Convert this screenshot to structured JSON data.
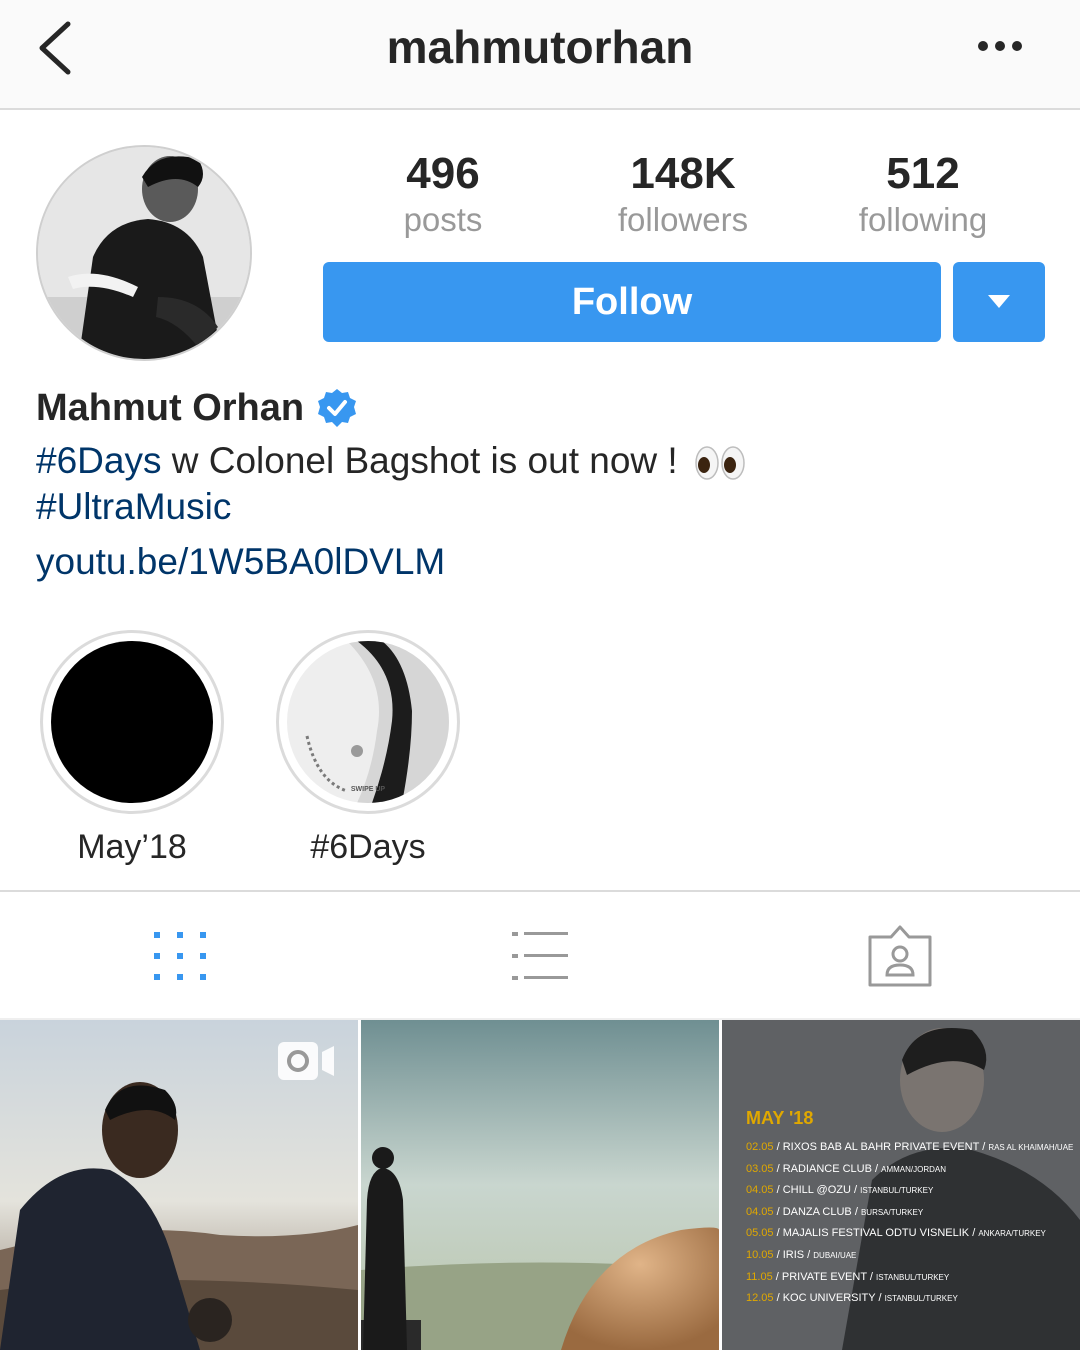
{
  "header": {
    "username": "mahmutorhan",
    "back_icon": "chevron-left-icon",
    "more_icon": "more-horizontal-icon"
  },
  "stats": {
    "posts_count": "496",
    "posts_label": "posts",
    "followers_count": "148K",
    "followers_label": "followers",
    "following_count": "512",
    "following_label": "following"
  },
  "actions": {
    "follow_label": "Follow",
    "accent_color": "#3897f0"
  },
  "bio": {
    "name": "Mahmut Orhan",
    "verified": true,
    "line1_tag": "#6Days",
    "line1_text": " w Colonel Bagshot is out now ! ",
    "line2_tag": "#UltraMusic",
    "link": "youtu.be/1W5BA0lDVLM",
    "link_color": "#003569"
  },
  "highlights": [
    {
      "label": "May’18"
    },
    {
      "label": "#6Days",
      "cover_text": "SWIPE UP"
    }
  ],
  "tabs": [
    {
      "name": "grid",
      "icon": "grid-icon",
      "active": true
    },
    {
      "name": "list",
      "icon": "list-icon",
      "active": false
    },
    {
      "name": "tagged",
      "icon": "tagged-person-icon",
      "active": false
    }
  ],
  "posts": [
    {
      "type": "video",
      "badge_icon": "video-camera-icon"
    },
    {
      "type": "photo"
    },
    {
      "type": "photo",
      "tour_title": "MAY '18",
      "tour_dates": [
        {
          "date": "02.05",
          "venue": " / RIXOS BAB AL BAHR PRIVATE EVENT / ",
          "location": "RAS AL KHAIMAH/UAE"
        },
        {
          "date": "03.05",
          "venue": " / RADIANCE CLUB / ",
          "location": "AMMAN/JORDAN"
        },
        {
          "date": "04.05",
          "venue": " / CHILL @OZU / ",
          "location": "ISTANBUL/TURKEY"
        },
        {
          "date": "04.05",
          "venue": " / DANZA CLUB / ",
          "location": "BURSA/TURKEY"
        },
        {
          "date": "05.05",
          "venue": " / MAJALIS FESTIVAL ODTU VISNELIK / ",
          "location": "ANKARA/TURKEY"
        },
        {
          "date": "10.05",
          "venue": " / IRIS / ",
          "location": "DUBAI/UAE"
        },
        {
          "date": "11.05",
          "venue": " / PRIVATE EVENT / ",
          "location": "ISTANBUL/TURKEY"
        },
        {
          "date": "12.05",
          "venue": " / KOC UNIVERSITY / ",
          "location": "ISTANBUL/TURKEY"
        }
      ]
    }
  ]
}
